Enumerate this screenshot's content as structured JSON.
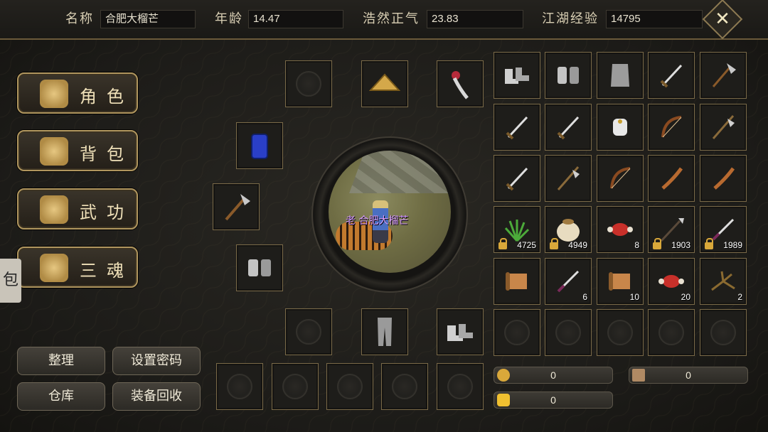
{
  "header": {
    "name_label": "名称",
    "name_value": "合肥大榴芒",
    "age_label": "年龄",
    "age_value": "14.47",
    "righteous_label": "浩然正气",
    "righteous_value": "23.83",
    "exp_label": "江湖经验",
    "exp_value": "14795",
    "close_label": "✕"
  },
  "menu": {
    "items": [
      {
        "label": "角色",
        "icon": "character-icon"
      },
      {
        "label": "背包",
        "icon": "backpack-icon"
      },
      {
        "label": "武功",
        "icon": "martial-arts-scroll-icon"
      },
      {
        "label": "三魂",
        "icon": "three-souls-icon"
      }
    ],
    "side_tab": "包"
  },
  "buttons": {
    "sort": "整理",
    "set_password": "设置密码",
    "warehouse": "仓库",
    "recycle": "装备回收"
  },
  "portrait": {
    "character_name": "老 合肥大榴芒"
  },
  "inventory": {
    "rows": [
      [
        {
          "icon": "boots-icon"
        },
        {
          "icon": "bracers-icon"
        },
        {
          "icon": "armor-icon"
        },
        {
          "icon": "sword-icon"
        },
        {
          "icon": "axe-icon"
        }
      ],
      [
        {
          "icon": "sword-icon"
        },
        {
          "icon": "sword-icon"
        },
        {
          "icon": "gauntlet-icon"
        },
        {
          "icon": "bow-icon"
        },
        {
          "icon": "halberd-icon"
        }
      ],
      [
        {
          "icon": "sword-icon"
        },
        {
          "icon": "halberd-icon"
        },
        {
          "icon": "bow-icon"
        },
        {
          "icon": "blade-icon"
        },
        {
          "icon": "blade-icon"
        }
      ],
      [
        {
          "icon": "herb-icon",
          "qty": "4725",
          "locked": true
        },
        {
          "icon": "sack-icon",
          "qty": "4949",
          "locked": true
        },
        {
          "icon": "meat-icon",
          "qty": "8"
        },
        {
          "icon": "spear-icon",
          "qty": "1903",
          "locked": true
        },
        {
          "icon": "dagger-icon",
          "qty": "1989",
          "locked": true
        }
      ],
      [
        {
          "icon": "scroll-icon"
        },
        {
          "icon": "dagger-icon",
          "qty": "6"
        },
        {
          "icon": "scroll-icon",
          "qty": "10"
        },
        {
          "icon": "meat-icon",
          "qty": "20"
        },
        {
          "icon": "branch-icon",
          "qty": "2"
        }
      ],
      [
        {
          "icon": "empty"
        },
        {
          "icon": "empty"
        },
        {
          "icon": "empty"
        },
        {
          "icon": "empty"
        },
        {
          "icon": "empty"
        }
      ]
    ]
  },
  "currency": {
    "coin": "0",
    "token": "0",
    "gold": "0"
  },
  "colors": {
    "accent_gold": "#b0965e",
    "slot_border": "#7a6a48",
    "name_purple": "#d79cff"
  }
}
